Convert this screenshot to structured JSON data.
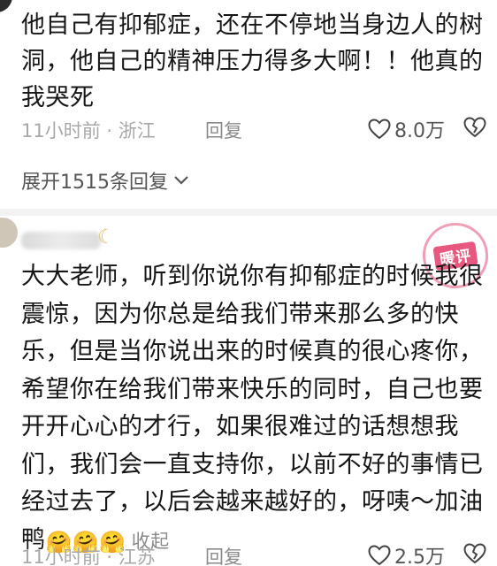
{
  "comment1": {
    "text": "他自己有抑郁症，还在不停地当身边人的树洞，他自己的精神压力得多大啊！！他真的我哭死",
    "time": "11小时前 · 浙江",
    "reply_label": "回复",
    "like_count": "8.0万"
  },
  "expand_replies": "展开1515条回复",
  "comment2": {
    "username": "",
    "text": "大大老师，听到你说你有抑郁症的时候我很震惊，因为你总是给我们带来那么多的快乐，但是当你说出来的时候真的很心疼你，希望你在给我们带来快乐的同时，自己也要开开心心的才行，如果很难过的话想想我们，我们会一直支持你，以前不好的事情已经过去了，以后会越来越好的，呀咦～加油鸭",
    "emoji": "🤗🤗🤗",
    "collapse_label": "收起",
    "time": "11小时前 · 江苏",
    "reply_label": "回复",
    "like_count": "2.5万"
  },
  "watermark": {
    "label": "暖评",
    "color": "#e8587e"
  },
  "icons": {
    "like": "heart-outline-icon",
    "dislike": "broken-heart-icon",
    "expand": "chevron-down-icon"
  }
}
